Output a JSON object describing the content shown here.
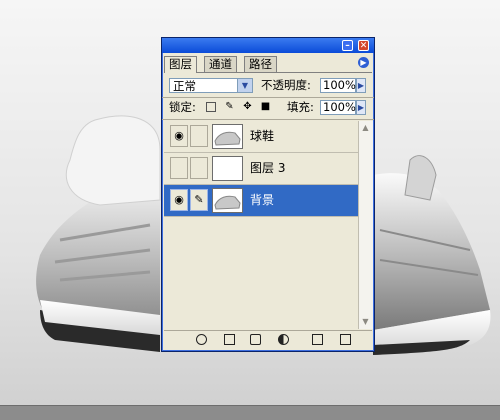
{
  "palette": {
    "tabs": [
      {
        "label": "图层",
        "active": true
      },
      {
        "label": "通道",
        "active": false
      },
      {
        "label": "路径",
        "active": false
      }
    ],
    "blend_mode": "正常",
    "opacity_label": "不透明度:",
    "opacity_value": "100%",
    "lock_label": "锁定:",
    "fill_label": "填充:",
    "fill_value": "100%",
    "layers": [
      {
        "name": "球鞋",
        "visible": true,
        "selected": false,
        "thumbnail": "shoe-thumbnail"
      },
      {
        "name": "图层 3",
        "visible": false,
        "selected": false,
        "thumbnail": "blank-thumbnail"
      },
      {
        "name": "背景",
        "visible": true,
        "selected": true,
        "thumbnail": "shoe-thumbnail"
      }
    ],
    "icons": {
      "eye": "eye-icon",
      "brush": "brush-icon",
      "lock_transparency": "lock-transparency-icon",
      "lock_paint": "lock-paint-icon",
      "lock_move": "lock-move-icon",
      "lock_all": "lock-all-icon",
      "bottom": [
        "link-icon",
        "layer-style-icon",
        "mask-icon",
        "folder-icon",
        "adjustment-icon",
        "new-layer-icon",
        "trash-icon"
      ]
    },
    "colors": {
      "selection": "#316ac5",
      "title_bar": "#0a4bd8",
      "panel": "#ece9d8"
    }
  }
}
